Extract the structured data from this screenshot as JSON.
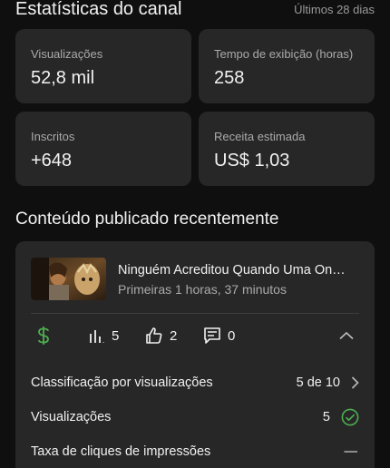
{
  "header": {
    "title": "Estatísticas do canal",
    "period": "Últimos 28 dias"
  },
  "stats": [
    {
      "label": "Visualizações",
      "value": "52,8 mil"
    },
    {
      "label": "Tempo de exibição (horas)",
      "value": "258"
    },
    {
      "label": "Inscritos",
      "value": "+648"
    },
    {
      "label": "Receita estimada",
      "value": "US$ 1,03"
    }
  ],
  "recent": {
    "section_title": "Conteúdo publicado recentemente",
    "video": {
      "title": "Ninguém Acreditou Quando Uma On…",
      "subtitle": "Primeiras 1 horas, 37 minutos"
    },
    "metrics": {
      "monetization_icon": "dollar-icon",
      "views_count": "5",
      "likes_count": "2",
      "comments_count": "0"
    },
    "rows": [
      {
        "label": "Classificação por visualizações",
        "value": "5 de 10"
      },
      {
        "label": "Visualizações",
        "value": "5"
      },
      {
        "label": "Taxa de cliques de impressões",
        "value": "—"
      }
    ]
  },
  "colors": {
    "background": "#0f0f0f",
    "card": "#272727",
    "accent_green": "#4caf50"
  }
}
